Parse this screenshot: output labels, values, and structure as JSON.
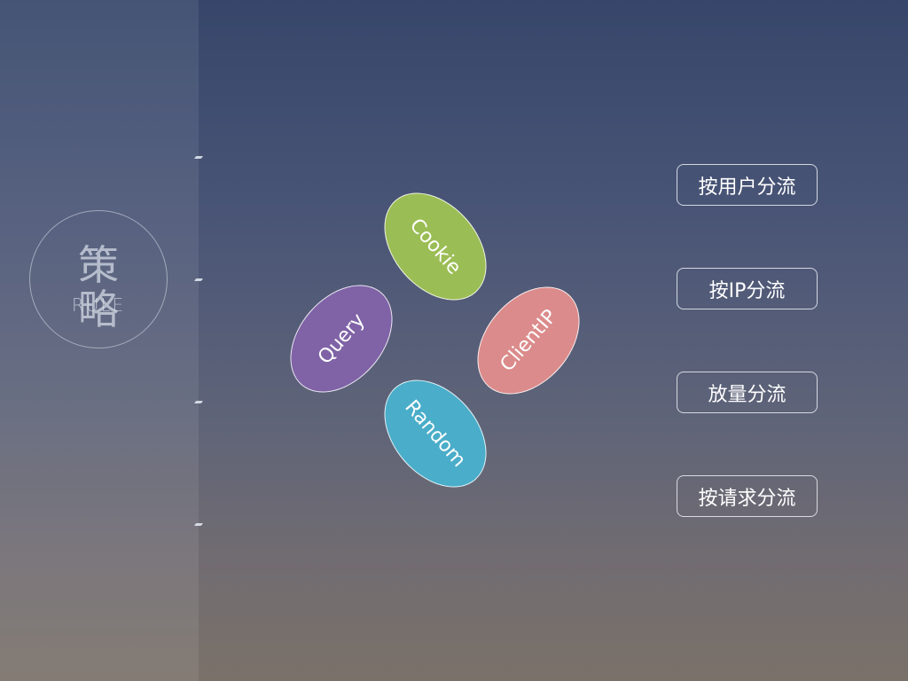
{
  "rule_badge": {
    "title": "策 略",
    "subtitle": "RULE"
  },
  "petals": [
    {
      "label": "Cookie",
      "color": "#9bbd55"
    },
    {
      "label": "Query",
      "color": "#7f63a6"
    },
    {
      "label": "ClientIP",
      "color": "#db8b8b"
    },
    {
      "label": "Random",
      "color": "#4aadc9"
    }
  ],
  "strategies": [
    {
      "label": "按用户分流"
    },
    {
      "label": "按IP分流"
    },
    {
      "label": "放量分流"
    },
    {
      "label": "按请求分流"
    }
  ],
  "colors": {
    "sidebar_tint": "rgba(255,255,255,0.08)",
    "button_border": "#ebeef5"
  }
}
